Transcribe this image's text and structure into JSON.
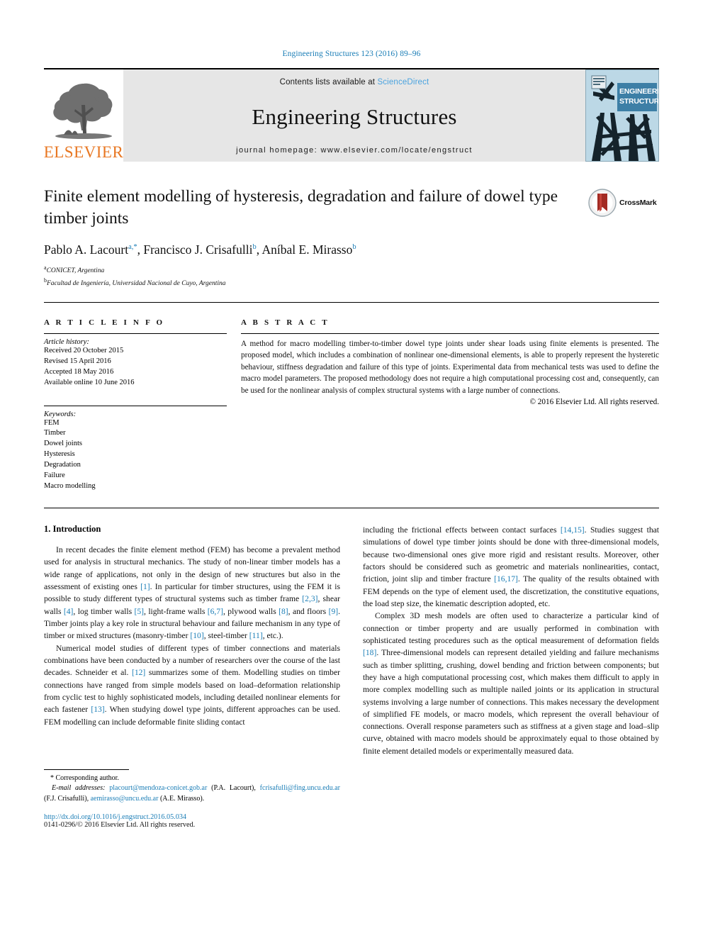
{
  "running_head": "Engineering Structures 123 (2016) 89–96",
  "masthead": {
    "publisher_name": "ELSEVIER",
    "contents_prefix": "Contents lists available at ",
    "sciencedirect": "ScienceDirect",
    "journal_name": "Engineering Structures",
    "homepage": "journal homepage: www.elsevier.com/locate/engstruct",
    "cover_title_line1": "ENGINEERING",
    "cover_title_line2": "STRUCTURES",
    "band_bg": "#e6e6e6",
    "link_color": "#4aa3df",
    "elsevier_orange": "#E87722"
  },
  "title": "Finite element modelling of hysteresis, degradation and failure of dowel type timber joints",
  "crossmark_label": "CrossMark",
  "authors": [
    {
      "name": "Pablo A. Lacourt",
      "marks": "a,*"
    },
    {
      "name": "Francisco J. Crisafulli",
      "marks": "b"
    },
    {
      "name": "Aníbal E. Mirasso",
      "marks": "b"
    }
  ],
  "authors_line": "Pablo A. Lacourt a,*, Francisco J. Crisafulli b, Aníbal E. Mirasso b",
  "affiliations": [
    {
      "mark": "a",
      "text": "CONICET, Argentina"
    },
    {
      "mark": "b",
      "text": "Facultad de Ingeniería, Universidad Nacional de Cuyo, Argentina"
    }
  ],
  "article_info": {
    "heading": "A R T I C L E  I N F O",
    "history_label": "Article history:",
    "history": [
      "Received 20 October 2015",
      "Revised 15 April 2016",
      "Accepted 18 May 2016",
      "Available online 10 June 2016"
    ],
    "keywords_label": "Keywords:",
    "keywords": [
      "FEM",
      "Timber",
      "Dowel joints",
      "Hysteresis",
      "Degradation",
      "Failure",
      "Macro modelling"
    ]
  },
  "abstract": {
    "heading": "A B S T R A C T",
    "text": "A method for macro modelling timber-to-timber dowel type joints under shear loads using finite elements is presented. The proposed model, which includes a combination of nonlinear one-dimensional elements, is able to properly represent the hysteretic behaviour, stiffness degradation and failure of this type of joints. Experimental data from mechanical tests was used to define the macro model parameters. The proposed methodology does not require a high computational processing cost and, consequently, can be used for the nonlinear analysis of complex structural systems with a large number of connections.",
    "copyright": "© 2016 Elsevier Ltd. All rights reserved."
  },
  "body": {
    "section_heading": "1. Introduction",
    "left_paragraphs": [
      "In recent decades the finite element method (FEM) has become a prevalent method used for analysis in structural mechanics. The study of non-linear timber models has a wide range of applications, not only in the design of new structures but also in the assessment of existing ones [1]. In particular for timber structures, using the FEM it is possible to study different types of structural systems such as timber frame [2,3], shear walls [4], log timber walls [5], light-frame walls [6,7], plywood walls [8], and floors [9]. Timber joints play a key role in structural behaviour and failure mechanism in any type of timber or mixed structures (masonry-timber [10], steel-timber [11], etc.).",
      "Numerical model studies of different types of timber connections and materials combinations have been conducted by a number of researchers over the course of the last decades. Schneider et al. [12] summarizes some of them. Modelling studies on timber connections have ranged from simple models based on load–deformation relationship from cyclic test to highly sophisticated models, including detailed nonlinear elements for each fastener [13]. When studying dowel type joints, different approaches can be used. FEM modelling can include deformable finite sliding contact"
    ],
    "right_paragraphs": [
      "including the frictional effects between contact surfaces [14,15]. Studies suggest that simulations of dowel type timber joints should be done with three-dimensional models, because two-dimensional ones give more rigid and resistant results. Moreover, other factors should be considered such as geometric and materials nonlinearities, contact, friction, joint slip and timber fracture [16,17]. The quality of the results obtained with FEM depends on the type of element used, the discretization, the constitutive equations, the load step size, the kinematic description adopted, etc.",
      "Complex 3D mesh models are often used to characterize a particular kind of connection or timber property and are usually performed in combination with sophisticated testing procedures such as the optical measurement of deformation fields [18]. Three-dimensional models can represent detailed yielding and failure mechanisms such as timber splitting, crushing, dowel bending and friction between components; but they have a high computational processing cost, which makes them difficult to apply in more complex modelling such as multiple nailed joints or its application in structural systems involving a large number of connections. This makes necessary the development of simplified FE models, or macro models, which represent the overall behaviour of connections. Overall response parameters such as stiffness at a given stage and load–slip curve, obtained with macro models should be approximately equal to those obtained by finite element detailed models or experimentally measured data."
    ]
  },
  "footnote": {
    "corresponding": "* Corresponding author.",
    "email_label": "E-mail addresses:",
    "emails": [
      {
        "address": "placourt@mendoza-conicet.gob.ar",
        "who": "(P.A. Lacourt)"
      },
      {
        "address": "fcrisafulli@fing.uncu.edu.ar",
        "who": "(F.J. Crisafulli)"
      },
      {
        "address": "aemirasso@uncu.edu.ar",
        "who": "(A.E. Mirasso)"
      }
    ],
    "doi": "http://dx.doi.org/10.1016/j.engstruct.2016.05.034",
    "issn": "0141-0296/© 2016 Elsevier Ltd. All rights reserved."
  }
}
